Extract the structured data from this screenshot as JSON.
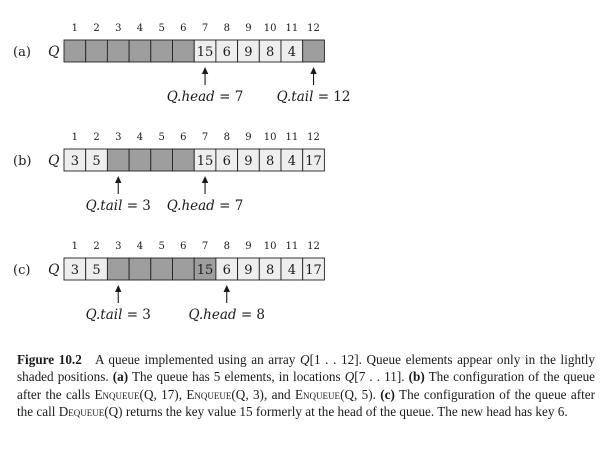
{
  "queue_label": "Q",
  "colors": {
    "shaded": "#9e9e9e",
    "light": "#eeeeee",
    "border": "#222222"
  },
  "column_indices": [
    "1",
    "2",
    "3",
    "4",
    "5",
    "6",
    "7",
    "8",
    "9",
    "10",
    "11",
    "12"
  ],
  "panels": [
    {
      "id": "a",
      "label": "(a)",
      "cells": [
        {
          "value": "",
          "shade": "dark"
        },
        {
          "value": "",
          "shade": "dark"
        },
        {
          "value": "",
          "shade": "dark"
        },
        {
          "value": "",
          "shade": "dark"
        },
        {
          "value": "",
          "shade": "dark"
        },
        {
          "value": "",
          "shade": "dark"
        },
        {
          "value": "15",
          "shade": "light"
        },
        {
          "value": "6",
          "shade": "light"
        },
        {
          "value": "9",
          "shade": "light"
        },
        {
          "value": "8",
          "shade": "light"
        },
        {
          "value": "4",
          "shade": "light"
        },
        {
          "value": "",
          "shade": "dark"
        }
      ],
      "pointers": [
        {
          "name": "head",
          "index": 7,
          "prefix": "Q",
          "field": "head",
          "value": "7"
        },
        {
          "name": "tail",
          "index": 12,
          "prefix": "Q",
          "field": "tail",
          "value": "12"
        }
      ]
    },
    {
      "id": "b",
      "label": "(b)",
      "cells": [
        {
          "value": "3",
          "shade": "light"
        },
        {
          "value": "5",
          "shade": "light"
        },
        {
          "value": "",
          "shade": "dark"
        },
        {
          "value": "",
          "shade": "dark"
        },
        {
          "value": "",
          "shade": "dark"
        },
        {
          "value": "",
          "shade": "dark"
        },
        {
          "value": "15",
          "shade": "light"
        },
        {
          "value": "6",
          "shade": "light"
        },
        {
          "value": "9",
          "shade": "light"
        },
        {
          "value": "8",
          "shade": "light"
        },
        {
          "value": "4",
          "shade": "light"
        },
        {
          "value": "17",
          "shade": "light"
        }
      ],
      "pointers": [
        {
          "name": "tail",
          "index": 3,
          "prefix": "Q",
          "field": "tail",
          "value": "3"
        },
        {
          "name": "head",
          "index": 7,
          "prefix": "Q",
          "field": "head",
          "value": "7"
        }
      ]
    },
    {
      "id": "c",
      "label": "(c)",
      "cells": [
        {
          "value": "3",
          "shade": "light"
        },
        {
          "value": "5",
          "shade": "light"
        },
        {
          "value": "",
          "shade": "dark"
        },
        {
          "value": "",
          "shade": "dark"
        },
        {
          "value": "",
          "shade": "dark"
        },
        {
          "value": "",
          "shade": "dark"
        },
        {
          "value": "15",
          "shade": "dark"
        },
        {
          "value": "6",
          "shade": "light"
        },
        {
          "value": "9",
          "shade": "light"
        },
        {
          "value": "8",
          "shade": "light"
        },
        {
          "value": "4",
          "shade": "light"
        },
        {
          "value": "17",
          "shade": "light"
        }
      ],
      "pointers": [
        {
          "name": "tail",
          "index": 3,
          "prefix": "Q",
          "field": "tail",
          "value": "3"
        },
        {
          "name": "head",
          "index": 8,
          "prefix": "Q",
          "field": "head",
          "value": "8"
        }
      ]
    }
  ],
  "caption": {
    "figure_label": "Figure 10.2",
    "s1": "A queue implemented using an array",
    "array_q": "Q",
    "array_range": "[1 . . 12]",
    "s2": ". Queue elements appear only in the lightly shaded positions.",
    "a_label": "(a)",
    "a_text": "The queue has 5 elements, in locations",
    "a_q": "Q",
    "a_range": "[7 . . 11]",
    "a_end": ".",
    "b_label": "(b)",
    "b_text": "The configuration of the queue after the calls",
    "op_enqueue": "Enqueue",
    "call1_args": "(Q, 17)",
    "call2_args": "(Q, 3)",
    "b_and": ", and",
    "call3_args": "(Q, 5)",
    "b_end": ".",
    "c_label": "(c)",
    "c_text": "The configuration of the queue after the call",
    "op_dequeue": "Dequeue",
    "call4_args": "(Q)",
    "c_end": "returns the key value 15 formerly at the head of the queue. The new head has key 6."
  }
}
